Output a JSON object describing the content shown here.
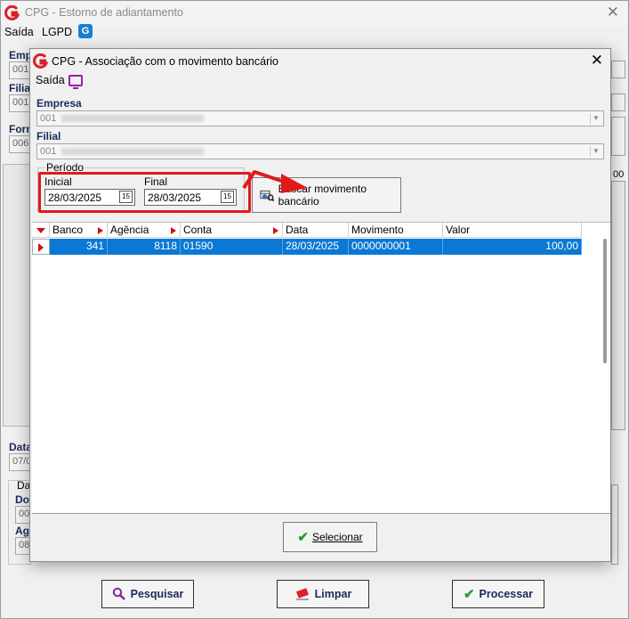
{
  "outer": {
    "title": "CPG - Estorno de adiantamento",
    "menu": [
      "Saída",
      "LGPD"
    ],
    "lgpd_icon": "G",
    "bg_labels": [
      "Emp",
      "Filia",
      "Forn",
      "Data",
      "Da",
      "Do",
      "Ag"
    ],
    "bg_values": [
      "001",
      "001",
      "0068",
      "07/0",
      "000",
      "08"
    ],
    "buttons": {
      "pesquisar": "Pesquisar",
      "limpar": "Limpar",
      "processar": "Processar"
    },
    "col_fragment": "00"
  },
  "dialog": {
    "title": "CPG - Associação com o movimento bancário",
    "menu_saida": "Saída",
    "empresa_label": "Empresa",
    "empresa_value": "001",
    "filial_label": "Filial",
    "filial_value": "001",
    "periodo_label": "Período",
    "inicial_label": "Inicial",
    "inicial_value": "28/03/2025",
    "final_label": "Final",
    "final_value": "28/03/2025",
    "calendar_glyph": "15",
    "buscar_label": "Buscar movimento bancário",
    "grid": {
      "columns": [
        "Banco",
        "Agência",
        "Conta",
        "Data",
        "Movimento",
        "Valor"
      ],
      "rows": [
        {
          "banco": "341",
          "agencia": "8118",
          "conta": "01590",
          "data": "28/03/2025",
          "movimento": "0000000001",
          "valor": "100,00"
        }
      ]
    },
    "selecionar_label": "Selecionar"
  },
  "colors": {
    "accent_red": "#e01a1a",
    "selection_blue": "#0a78d4",
    "label_navy": "#1a2a5a"
  }
}
